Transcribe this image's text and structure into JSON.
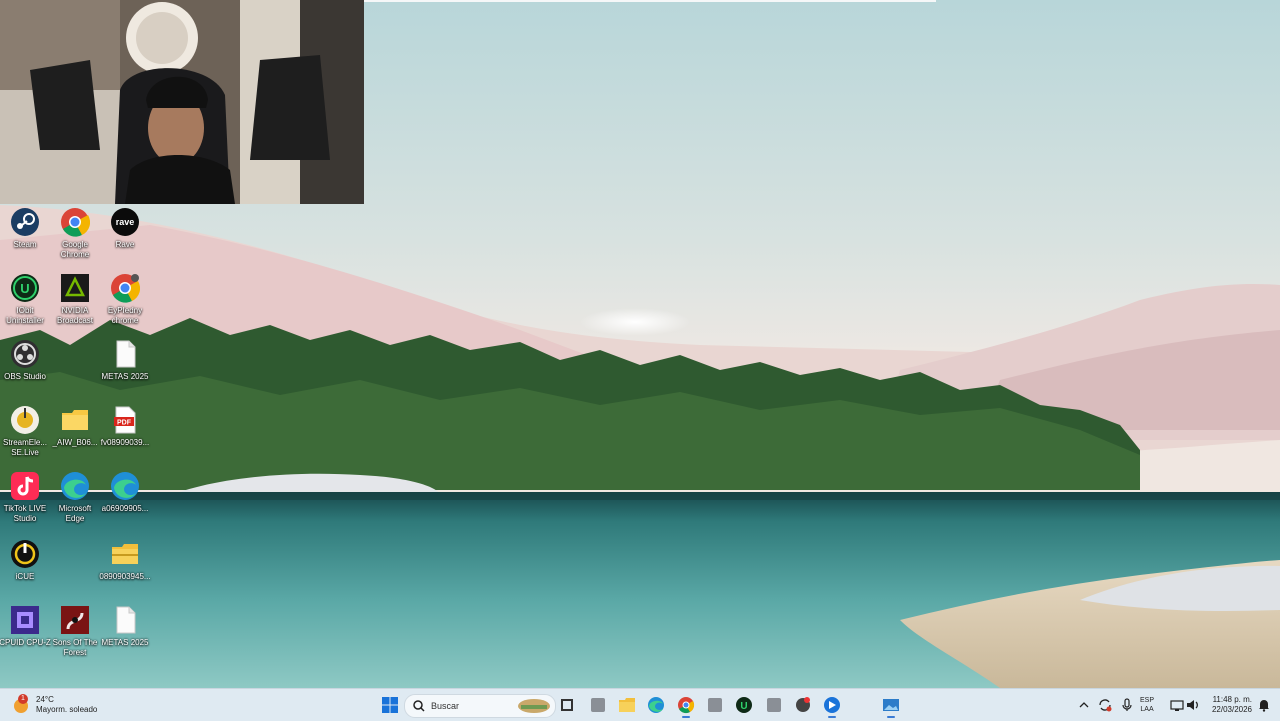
{
  "taskbar": {
    "weather": {
      "temperature": "24°C",
      "condition": "Mayorm. soleado",
      "badge": "1"
    },
    "search_placeholder": "Buscar",
    "language": {
      "line1": "ESP",
      "line2": "LAA"
    },
    "clock": {
      "time": "11:48 p. m.",
      "date": "22/03/2026"
    },
    "apps": [
      "start-icon",
      "search-icon",
      "widget-icon",
      "file-explorer-icon",
      "edge-icon",
      "chrome-icon",
      "app-icon",
      "iobit-icon",
      "app-icon",
      "app-icon",
      "teams-icon",
      "photos-icon"
    ]
  },
  "desktop": {
    "icons": [
      {
        "name": "steam-icon",
        "label": "Steam"
      },
      {
        "name": "google-chrome-icon",
        "label": "Google Chrome"
      },
      {
        "name": "rave-icon",
        "label": "Rave"
      },
      {
        "name": "iobit-uninstaller-icon",
        "label": "IObit Uninstaller"
      },
      {
        "name": "nvidia-broadcast-icon",
        "label": "NVIDIA Broadcast"
      },
      {
        "name": "chrome-profile-icon",
        "label": "EyPIedny chrome"
      },
      {
        "name": "obs-studio-icon",
        "label": "OBS Studio"
      },
      {
        "name": "metas-2025-file-icon",
        "label": "METAS 2025"
      },
      {
        "name": "streamelements-icon",
        "label": "StreamEle... SE.Live"
      },
      {
        "name": "folder-icon",
        "label": "_AIW_B06..."
      },
      {
        "name": "pdf-file-icon",
        "label": "fv08909039..."
      },
      {
        "name": "tiktok-live-studio-icon",
        "label": "TikTok LIVE Studio"
      },
      {
        "name": "microsoft-edge-icon",
        "label": "Microsoft Edge"
      },
      {
        "name": "edge-file-icon",
        "label": "a06909905..."
      },
      {
        "name": "icue-icon",
        "label": "iCUE"
      },
      {
        "name": "zip-folder-icon",
        "label": "0890903945..."
      },
      {
        "name": "cpuz-icon",
        "label": "CPUID CPU-Z"
      },
      {
        "name": "sons-of-the-forest-icon",
        "label": "Sons Of The Forest"
      },
      {
        "name": "metas-2025-file-2-icon",
        "label": "METAS 2025"
      }
    ]
  },
  "colors": {
    "sky": "#cfe0e0",
    "lake": "#3f8f8f",
    "taskbar": "#dfeaf2",
    "accent": "#3a7bd5"
  }
}
